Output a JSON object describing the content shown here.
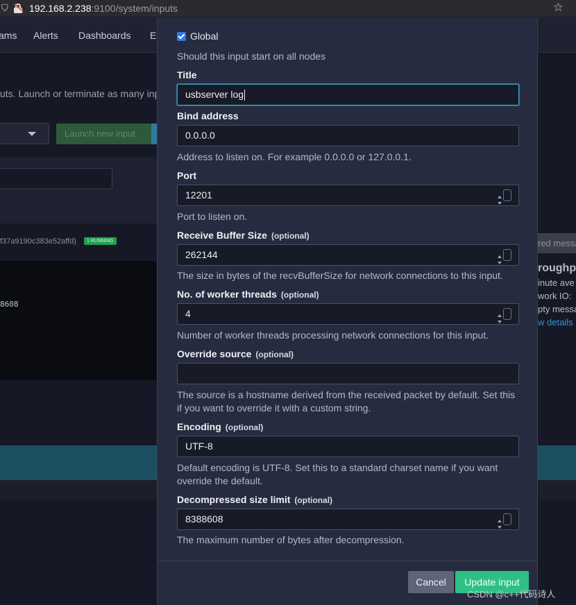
{
  "browser": {
    "url_host": "192.168.2.238",
    "url_rest": ":9100/system/inputs"
  },
  "background": {
    "nav_items": [
      "ams",
      "Alerts",
      "Dashboards",
      "Er"
    ],
    "intro_text": "uts. Launch or terminate as many inp",
    "launch_button": "Launch new input",
    "input_id": "f37a9190c383e52affd)",
    "running_badge": "1 RUNNING",
    "number_text": "8608",
    "right_badge": "red messa",
    "right_lines": [
      "roughpu",
      "inute ave",
      "work IO:",
      "pty messa",
      "w details"
    ]
  },
  "modal": {
    "global": {
      "label": "Global",
      "checked": true,
      "help": "Should this input start on all nodes"
    },
    "fields": [
      {
        "label": "Title",
        "optional": "",
        "value": "usbserver log",
        "help": ""
      },
      {
        "label": "Bind address",
        "optional": "",
        "value": "0.0.0.0",
        "help": "Address to listen on. For example 0.0.0.0 or 127.0.0.1."
      },
      {
        "label": "Port",
        "optional": "",
        "value": "12201",
        "help": "Port to listen on."
      },
      {
        "label": "Receive Buffer Size",
        "optional": "(optional)",
        "value": "262144",
        "help": "The size in bytes of the recvBufferSize for network connections to this input."
      },
      {
        "label": "No. of worker threads",
        "optional": "(optional)",
        "value": "4",
        "help": "Number of worker threads processing network connections for this input."
      },
      {
        "label": "Override source",
        "optional": "(optional)",
        "value": "",
        "help": "The source is a hostname derived from the received packet by default. Set this if you want to override it with a custom string."
      },
      {
        "label": "Encoding",
        "optional": "(optional)",
        "value": "UTF-8",
        "help": "Default encoding is UTF-8. Set this to a standard charset name if you want override the default."
      },
      {
        "label": "Decompressed size limit",
        "optional": "(optional)",
        "value": "8388608",
        "help": "The maximum number of bytes after decompression."
      }
    ],
    "cancel_label": "Cancel",
    "update_label": "Update input"
  },
  "watermark": "CSDN @c++代码诗人",
  "icons": [
    "shield-icon",
    "lock-icon",
    "star-icon",
    "checkbox-icon",
    "spinner-icon",
    "dropdown-caret-icon"
  ],
  "colors": {
    "primary": "#2fbf85",
    "focus": "#3fa3c8",
    "modal_bg": "#262b3f"
  }
}
